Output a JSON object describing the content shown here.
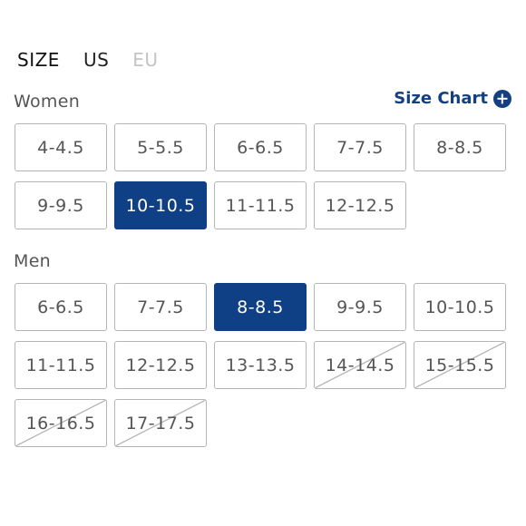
{
  "size_tabs": {
    "label": "SIZE",
    "us": "US",
    "eu": "EU"
  },
  "size_chart": {
    "label": "Size Chart"
  },
  "women": {
    "title": "Women",
    "sizes": [
      {
        "label": "4-4.5",
        "selected": false,
        "available": true
      },
      {
        "label": "5-5.5",
        "selected": false,
        "available": true
      },
      {
        "label": "6-6.5",
        "selected": false,
        "available": true
      },
      {
        "label": "7-7.5",
        "selected": false,
        "available": true
      },
      {
        "label": "8-8.5",
        "selected": false,
        "available": true
      },
      {
        "label": "9-9.5",
        "selected": false,
        "available": true
      },
      {
        "label": "10-10.5",
        "selected": true,
        "available": true
      },
      {
        "label": "11-11.5",
        "selected": false,
        "available": true
      },
      {
        "label": "12-12.5",
        "selected": false,
        "available": true
      }
    ]
  },
  "men": {
    "title": "Men",
    "sizes": [
      {
        "label": "6-6.5",
        "selected": false,
        "available": true
      },
      {
        "label": "7-7.5",
        "selected": false,
        "available": true
      },
      {
        "label": "8-8.5",
        "selected": true,
        "available": true
      },
      {
        "label": "9-9.5",
        "selected": false,
        "available": true
      },
      {
        "label": "10-10.5",
        "selected": false,
        "available": true
      },
      {
        "label": "11-11.5",
        "selected": false,
        "available": true
      },
      {
        "label": "12-12.5",
        "selected": false,
        "available": true
      },
      {
        "label": "13-13.5",
        "selected": false,
        "available": true
      },
      {
        "label": "14-14.5",
        "selected": false,
        "available": false
      },
      {
        "label": "15-15.5",
        "selected": false,
        "available": false
      },
      {
        "label": "16-16.5",
        "selected": false,
        "available": false
      },
      {
        "label": "17-17.5",
        "selected": false,
        "available": false
      }
    ]
  },
  "colors": {
    "accent": "#0f3f84",
    "link": "#14407f",
    "border": "#b5b5b5",
    "text": "#555555",
    "disabled_tab": "#c4c4c4"
  }
}
